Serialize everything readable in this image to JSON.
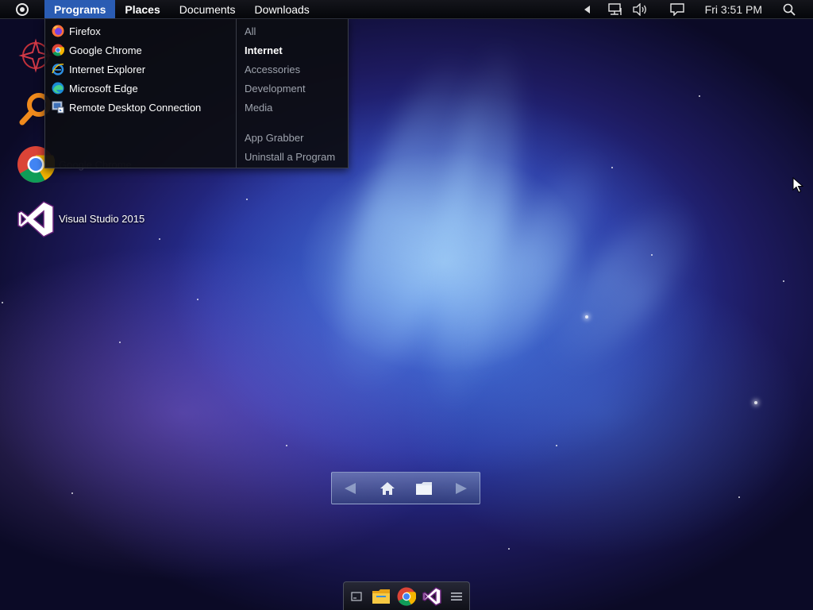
{
  "topbar": {
    "menus": [
      {
        "label": "Programs"
      },
      {
        "label": "Places"
      },
      {
        "label": "Documents"
      },
      {
        "label": "Downloads"
      }
    ],
    "clock": "Fri 3:51 PM"
  },
  "programs_menu": {
    "apps": [
      {
        "label": "Firefox",
        "icon": "firefox-icon"
      },
      {
        "label": "Google Chrome",
        "icon": "chrome-icon"
      },
      {
        "label": "Internet Explorer",
        "icon": "ie-icon"
      },
      {
        "label": "Microsoft Edge",
        "icon": "edge-icon"
      },
      {
        "label": "Remote Desktop Connection",
        "icon": "remote-desktop-icon"
      }
    ],
    "categories": [
      {
        "label": "All"
      },
      {
        "label": "Internet",
        "selected": true
      },
      {
        "label": "Accessories"
      },
      {
        "label": "Development"
      },
      {
        "label": "Media"
      }
    ],
    "actions": [
      {
        "label": "App Grabber"
      },
      {
        "label": "Uninstall a Program"
      }
    ]
  },
  "desktop_icons": [
    {
      "label": "Visual Studio 2015",
      "icon": "visual-studio-icon"
    }
  ],
  "colors": {
    "menu_highlight": "#2a5cb3",
    "vs_purple": "#68217a"
  }
}
